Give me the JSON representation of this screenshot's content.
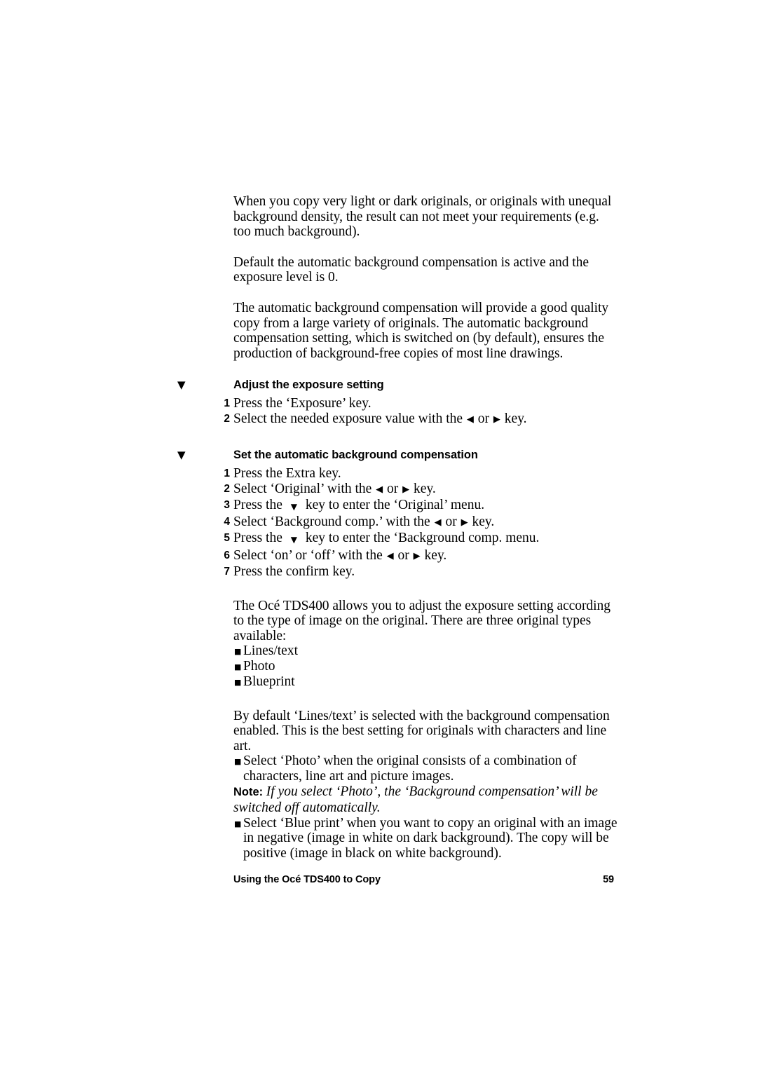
{
  "document": {
    "intro_paragraphs": [
      "When you copy very light or dark originals, or originals with unequal background density, the result can not meet your requirements (e.g. too much background).",
      "Default the automatic background compensation is active and the exposure level is 0.",
      "The automatic background compensation will provide a good quality copy from a large variety of originals. The automatic background compensation setting, which is switched on (by default), ensures the production of background-free copies of most line drawings."
    ],
    "sections": [
      {
        "marker": "▼",
        "heading": "Adjust the exposure setting",
        "steps": [
          {
            "num": "1",
            "pre": "Press the ‘Exposure’ key.",
            "arrow1": "",
            "mid": "",
            "arrow2": "",
            "post": ""
          },
          {
            "num": "2",
            "pre": "Select the needed exposure value with the ",
            "arrow1": "◀",
            "mid": " or ",
            "arrow2": "▶",
            "post": " key."
          }
        ]
      },
      {
        "marker": "▼",
        "heading": "Set the automatic background compensation",
        "steps": [
          {
            "num": "1",
            "pre": "Press the Extra key.",
            "arrow1": "",
            "mid": "",
            "arrow2": "",
            "post": ""
          },
          {
            "num": "2",
            "pre": "Select ‘Original’ with the ",
            "arrow1": "◀",
            "mid": " or ",
            "arrow2": "▶",
            "post": " key."
          },
          {
            "num": "3",
            "pre": "Press the ",
            "arrow1": "▼",
            "mid": "",
            "arrow2": "",
            "post": " key to enter the ‘Original’ menu."
          },
          {
            "num": "4",
            "pre": "Select ‘Background comp.’ with the ",
            "arrow1": "◀",
            "mid": " or ",
            "arrow2": "▶",
            "post": " key."
          },
          {
            "num": "5",
            "pre": "Press the ",
            "arrow1": "▼",
            "mid": "",
            "arrow2": "",
            "post": " key to enter the ‘Background comp. menu."
          },
          {
            "num": "6",
            "pre": "Select ‘on’ or ‘off’ with the ",
            "arrow1": "◀",
            "mid": " or ",
            "arrow2": "▶",
            "post": " key."
          },
          {
            "num": "7",
            "pre": "Press the confirm key.",
            "arrow1": "",
            "mid": "",
            "arrow2": "",
            "post": ""
          }
        ]
      }
    ],
    "original_types_intro": "The Océ TDS400 allows you to adjust the exposure setting according to the type of image on the original. There are three original types available:",
    "original_types": [
      {
        "bullet": "■",
        "label": "Lines/text"
      },
      {
        "bullet": "■",
        "label": "Photo"
      },
      {
        "bullet": "■",
        "label": "Blueprint"
      }
    ],
    "default_paragraph": "By default ‘Lines/text’ is selected with the background compensation enabled. This is the best setting for originals with characters and line art.",
    "photo_bullet": {
      "bullet": "■",
      "text": "Select ‘Photo’ when the original consists of a combination of characters, line art and picture images."
    },
    "note": {
      "label": "Note:",
      "body": "If you select ‘Photo’, the ‘Background compensation’ will be switched off automatically."
    },
    "blueprint_bullet": {
      "bullet": "■",
      "text": "Select ‘Blue print’ when you want to copy an original with an image in negative (image in white on dark background). The copy will be positive (image in black on white background)."
    },
    "footer": {
      "chapter": "Using the Océ TDS400 to Copy",
      "page_number": "59"
    }
  }
}
